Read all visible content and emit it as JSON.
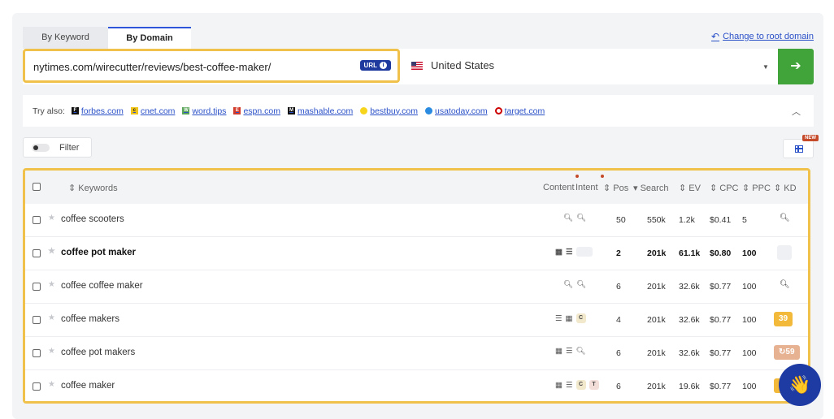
{
  "tabs": {
    "by_keyword": "By Keyword",
    "by_domain": "By Domain"
  },
  "root_link": {
    "label": "Change to root domain"
  },
  "search": {
    "url": "nytimes.com/wirecutter/reviews/best-coffee-maker/",
    "badge": "URL",
    "country": "United States",
    "go_icon": "arrow-right-icon"
  },
  "try_also": {
    "label": "Try also:",
    "sites": [
      {
        "name": "forbes.com",
        "color": "#111111",
        "glyph": "F"
      },
      {
        "name": "cnet.com",
        "color": "#f0c419",
        "glyph": "c"
      },
      {
        "name": "word.tips",
        "color": "#5aa55a",
        "glyph": "W"
      },
      {
        "name": "espn.com",
        "color": "#d23a2a",
        "glyph": "E"
      },
      {
        "name": "mashable.com",
        "color": "#111111",
        "glyph": "M"
      },
      {
        "name": "bestbuy.com",
        "color": "#f7d51d",
        "glyph": "•"
      },
      {
        "name": "usatoday.com",
        "color": "#2a8be0",
        "glyph": "●"
      },
      {
        "name": "target.com",
        "color": "#cc0000",
        "glyph": "◎"
      }
    ]
  },
  "filter": {
    "label": "Filter"
  },
  "columns_badge": "NEW",
  "table": {
    "headers": {
      "keywords": "Keywords",
      "content": "Content",
      "intent": "Intent",
      "pos": "Pos",
      "search": "Search",
      "ev": "EV",
      "cpc": "CPC",
      "ppc": "PPC",
      "kd": "KD"
    },
    "rows": [
      {
        "keyword": "coffee scooters",
        "pos": "50",
        "search": "550k",
        "ev": "1.2k",
        "cpc": "$0.41",
        "ppc": "5",
        "kd": "",
        "kd_kind": "search"
      },
      {
        "keyword": "coffee pot maker",
        "pos": "2",
        "search": "201k",
        "ev": "61.1k",
        "cpc": "$0.80",
        "ppc": "100",
        "kd": "",
        "kd_kind": "gray"
      },
      {
        "keyword": "coffee coffee maker",
        "pos": "6",
        "search": "201k",
        "ev": "32.6k",
        "cpc": "$0.77",
        "ppc": "100",
        "kd": "",
        "kd_kind": "search"
      },
      {
        "keyword": "coffee makers",
        "pos": "4",
        "search": "201k",
        "ev": "32.6k",
        "cpc": "$0.77",
        "ppc": "100",
        "kd": "39",
        "kd_kind": "yellow"
      },
      {
        "keyword": "coffee pot makers",
        "pos": "6",
        "search": "201k",
        "ev": "32.6k",
        "cpc": "$0.77",
        "ppc": "100",
        "kd": "59",
        "kd_kind": "orange"
      },
      {
        "keyword": "coffee maker",
        "pos": "6",
        "search": "201k",
        "ev": "19.6k",
        "cpc": "$0.77",
        "ppc": "100",
        "kd": "",
        "kd_kind": "yellow"
      }
    ],
    "intent_labels": {
      "c": "C",
      "t": "T"
    }
  }
}
